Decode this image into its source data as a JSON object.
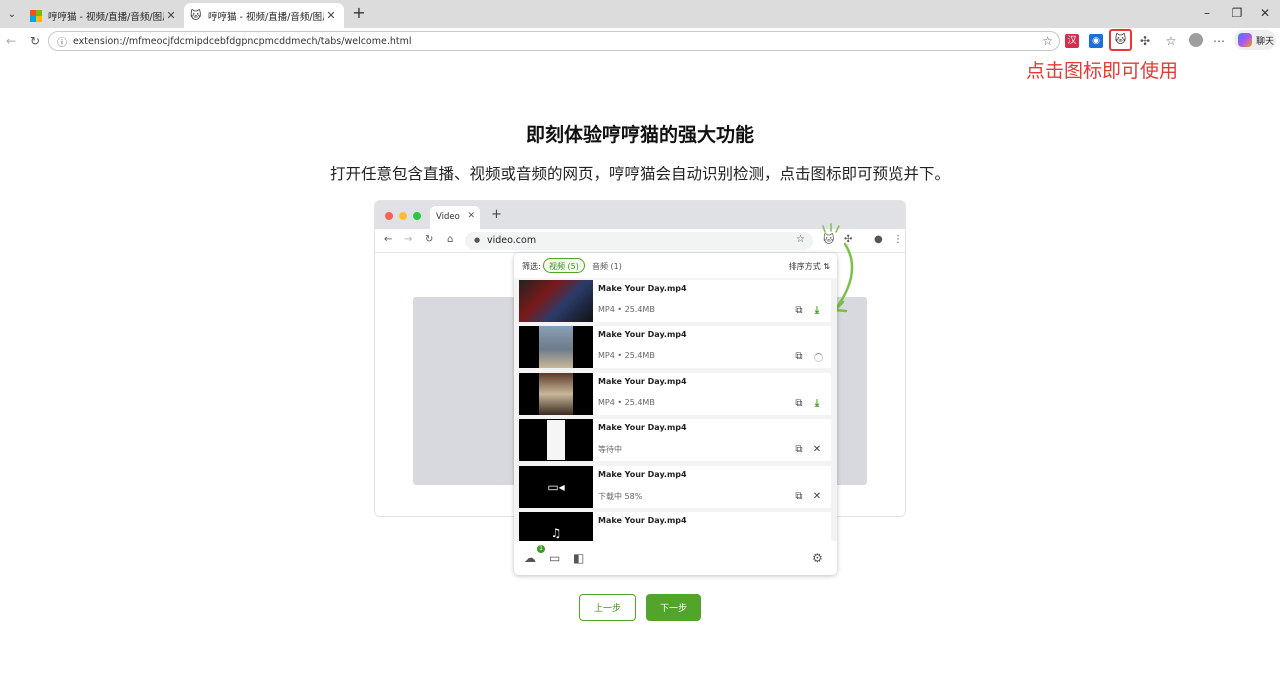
{
  "browser": {
    "tabs": [
      {
        "title": "哼哼猫 - 视频/直播/音频/图片下载",
        "active": false
      },
      {
        "title": "哼哼猫 - 视频/直播/音频/图片下载",
        "active": true
      }
    ],
    "url": "extension://mfmeocjfdcmipdcebfdgpncpmcddmech/tabs/welcome.html",
    "copilot_label": "聊天"
  },
  "hint": "点击图标即可使用",
  "main": {
    "title": "即刻体验哼哼猫的强大功能",
    "subtitle": "打开任意包含直播、视频或音频的网页，哼哼猫会自动识别检测，点击图标即可预览并下。"
  },
  "mock_browser": {
    "tab_title": "Video",
    "url": "video.com"
  },
  "popup": {
    "filter_label": "筛选:",
    "chip_video": "视频 (5)",
    "chip_audio": "音频 (1)",
    "sort_label": "排序方式",
    "items": [
      {
        "name": "Make Your Day.mp4",
        "meta": "MP4 • 25.4MB",
        "state": "download"
      },
      {
        "name": "Make Your Day.mp4",
        "meta": "MP4 • 25.4MB",
        "state": "loading"
      },
      {
        "name": "Make Your Day.mp4",
        "meta": "MP4 • 25.4MB",
        "state": "download"
      },
      {
        "name": "Make Your Day.mp4",
        "meta": "等待中",
        "state": "waiting"
      },
      {
        "name": "Make Your Day.mp4",
        "meta": "下载中  58%",
        "state": "downloading"
      },
      {
        "name": "Make Your Day.mp4",
        "meta": "",
        "state": "partial"
      }
    ],
    "badge_count": "1"
  },
  "buttons": {
    "prev": "上一步",
    "next": "下一步"
  },
  "colors": {
    "accent_green": "#52a42a",
    "hint_red": "#e53935"
  }
}
